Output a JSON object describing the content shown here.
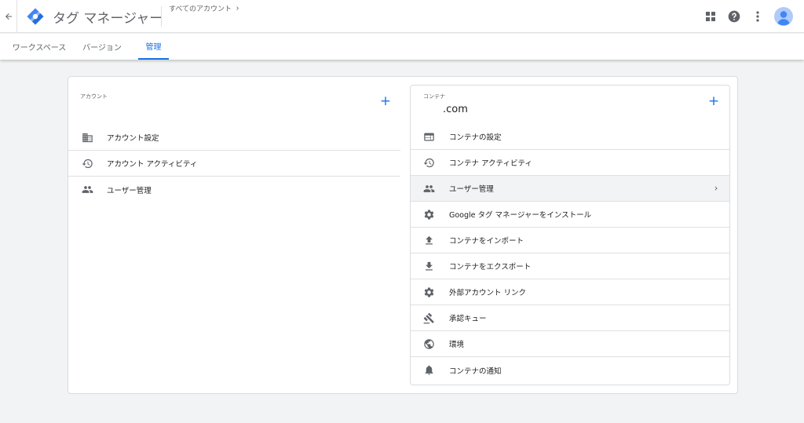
{
  "header": {
    "app_title": "タグ マネージャー",
    "breadcrumb": "すべてのアカウント",
    "icons": [
      "back-arrow-icon",
      "gtm-logo",
      "apps-grid-icon",
      "help-icon",
      "more-vert-icon",
      "avatar"
    ]
  },
  "tabs": [
    {
      "label": "ワークスペース",
      "active": false
    },
    {
      "label": "バージョン",
      "active": false
    },
    {
      "label": "管理",
      "active": true
    }
  ],
  "account": {
    "section_label": "アカウント",
    "add_symbol": "+",
    "items": [
      {
        "label": "アカウント設定",
        "icon": "building-icon"
      },
      {
        "label": "アカウント アクティビティ",
        "icon": "history-icon"
      },
      {
        "label": "ユーザー管理",
        "icon": "people-icon"
      }
    ]
  },
  "container": {
    "section_label": "コンテナ",
    "name_suffix": ".com",
    "add_symbol": "+",
    "items": [
      {
        "label": "コンテナの設定",
        "icon": "web-icon"
      },
      {
        "label": "コンテナ アクティビティ",
        "icon": "history-icon"
      },
      {
        "label": "ユーザー管理",
        "icon": "people-icon",
        "highlighted": true
      },
      {
        "label": "Google タグ マネージャーをインストール",
        "icon": "gear-icon"
      },
      {
        "label": "コンテナをインポート",
        "icon": "upload-icon"
      },
      {
        "label": "コンテナをエクスポート",
        "icon": "download-icon"
      },
      {
        "label": "外部アカウント リンク",
        "icon": "gear-icon"
      },
      {
        "label": "承認キュー",
        "icon": "gavel-icon"
      },
      {
        "label": "環境",
        "icon": "globe-icon"
      },
      {
        "label": "コンテナの通知",
        "icon": "bell-icon"
      }
    ]
  },
  "colors": {
    "accent": "#1a73e8",
    "icon": "#5f6368",
    "background": "#f1f3f4"
  }
}
